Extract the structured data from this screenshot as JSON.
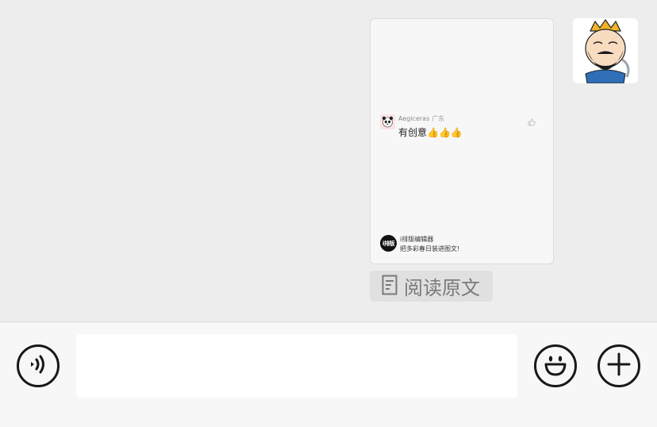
{
  "article_card": {
    "comment": {
      "username": "Aegiceras",
      "location": "广东",
      "text": "有创意👍👍👍",
      "avatar_icon": "panda-avatar-icon",
      "like_icon": "thumbs-up-icon"
    },
    "brand": {
      "logo_text": "i排版",
      "name": "i排版编辑器",
      "slogan": "把多彩春日装进图文!"
    }
  },
  "read_original": {
    "icon": "document-icon",
    "label": "阅读原文"
  },
  "user_avatar": {
    "icon": "cartoon-king-avatar-icon"
  },
  "input_bar": {
    "voice_icon": "voice-icon",
    "text_value": "",
    "emoji_icon": "smiley-icon",
    "plus_icon": "plus-icon"
  },
  "colors": {
    "chat_background": "#ededed",
    "input_bar_background": "#f7f7f7",
    "icon_stroke": "#181818"
  }
}
